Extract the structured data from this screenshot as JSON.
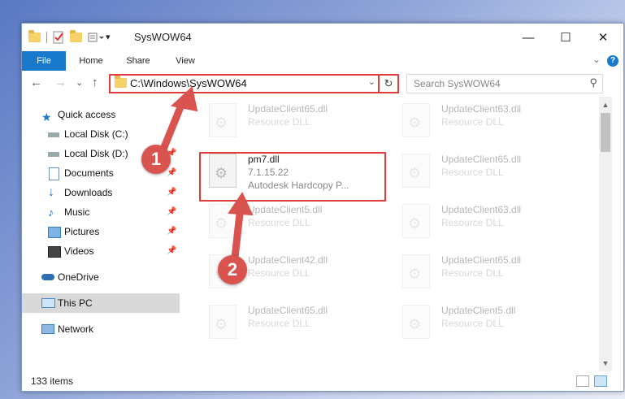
{
  "window": {
    "title": "SysWOW64",
    "controls": {
      "minimize": "—",
      "maximize": "☐",
      "close": "✕"
    }
  },
  "ribbon": {
    "tabs": [
      "File",
      "Home",
      "Share",
      "View"
    ],
    "help": "?"
  },
  "nav": {
    "back": "←",
    "forward": "→",
    "recent": "⌄",
    "up": "↑",
    "address": "C:\\Windows\\SysWOW64",
    "refresh": "↻",
    "search_placeholder": "Search SysWOW64"
  },
  "sidebar": {
    "items": [
      {
        "label": "Quick access",
        "icon": "star-icon",
        "pinned": false
      },
      {
        "label": "Local Disk (C:)",
        "icon": "drive-icon",
        "pinned": false
      },
      {
        "label": "Local Disk (D:)",
        "icon": "drive-icon",
        "pinned": true
      },
      {
        "label": "Documents",
        "icon": "documents-icon",
        "pinned": true
      },
      {
        "label": "Downloads",
        "icon": "download-icon",
        "pinned": true
      },
      {
        "label": "Music",
        "icon": "music-icon",
        "pinned": true
      },
      {
        "label": "Pictures",
        "icon": "pictures-icon",
        "pinned": true
      },
      {
        "label": "Videos",
        "icon": "videos-icon",
        "pinned": true
      },
      {
        "label": "OneDrive",
        "icon": "cloud-icon",
        "pinned": false
      },
      {
        "label": "This PC",
        "icon": "computer-icon",
        "pinned": false,
        "selected": true
      },
      {
        "label": "Network",
        "icon": "network-icon",
        "pinned": false
      }
    ]
  },
  "files": [
    {
      "name": "UpdateClient65.dll",
      "desc1": "Resource DLL",
      "desc2": "",
      "faded": true
    },
    {
      "name": "UpdateClient63.dll",
      "desc1": "Resource DLL",
      "desc2": "",
      "faded": true
    },
    {
      "name": "pm7.dll",
      "desc1": "7.1.15.22",
      "desc2": "Autodesk Hardcopy P...",
      "faded": false
    },
    {
      "name": "UpdateClient65.dll",
      "desc1": "Resource DLL",
      "desc2": "",
      "faded": true
    },
    {
      "name": "UpdateClient5.dll",
      "desc1": "Resource DLL",
      "desc2": "",
      "faded": true
    },
    {
      "name": "UpdateClient63.dll",
      "desc1": "Resource DLL",
      "desc2": "",
      "faded": true
    },
    {
      "name": "UpdateClient42.dll",
      "desc1": "Resource DLL",
      "desc2": "",
      "faded": true
    },
    {
      "name": "UpdateClient65.dll",
      "desc1": "Resource DLL",
      "desc2": "",
      "faded": true
    },
    {
      "name": "UpdateClient65.dll",
      "desc1": "Resource DLL",
      "desc2": "",
      "faded": true
    },
    {
      "name": "UpdateClient5.dll",
      "desc1": "Resource DLL",
      "desc2": "",
      "faded": true
    }
  ],
  "status": {
    "item_count": "133 items"
  },
  "annotations": {
    "marker1": "1",
    "marker2": "2",
    "color": "#d9534f"
  }
}
